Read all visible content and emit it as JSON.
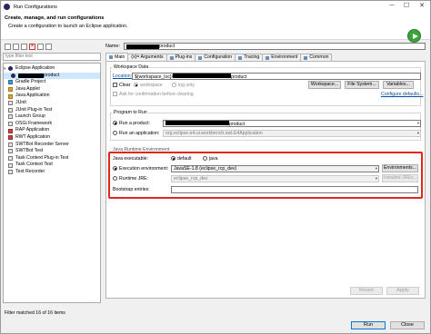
{
  "window": {
    "title": "Run Configurations",
    "min": "─",
    "max": "☐",
    "close": "✕"
  },
  "header": {
    "title": "Create, manage, and run configurations",
    "subtitle": "Create a configuration to launch an Eclipse application."
  },
  "left": {
    "filter_placeholder": "type filter text",
    "tree": [
      {
        "label": "Eclipse Application",
        "icon": "eclipse",
        "expanded": true
      },
      {
        "label": "product",
        "icon": "eclipse",
        "child": true,
        "selected": true
      },
      {
        "label": "Gradle Project",
        "icon": "gradle"
      },
      {
        "label": "Java Applet",
        "icon": "java"
      },
      {
        "label": "Java Application",
        "icon": "java"
      },
      {
        "label": "JUnit",
        "icon": "junit"
      },
      {
        "label": "JUnit Plug-in Test",
        "icon": "junit"
      },
      {
        "label": "Launch Group",
        "icon": "group"
      },
      {
        "label": "OSGi Framework",
        "icon": "osgi"
      },
      {
        "label": "RAP Application",
        "icon": "rap"
      },
      {
        "label": "RWT Application",
        "icon": "rap"
      },
      {
        "label": "SWTBot Recorder Server",
        "icon": "swtbot"
      },
      {
        "label": "SWTBot Test",
        "icon": "swtbot"
      },
      {
        "label": "Task Context Plug-in Test",
        "icon": "task"
      },
      {
        "label": "Task Context Test",
        "icon": "task"
      },
      {
        "label": "Test Recorder",
        "icon": "recorder"
      }
    ],
    "status": "Filter matched 16 of 16 items"
  },
  "form": {
    "name_label": "Name:",
    "name_value": "product",
    "tabs": [
      "Main",
      "(x)= Arguments",
      "Plug-ins",
      "Configuration",
      "Tracing",
      "Environment",
      "Common"
    ],
    "workspace": {
      "group": "Workspace Data",
      "location_label": "Location:",
      "location_value_prefix": "${workspace_loc}/",
      "location_value_suffix": "product",
      "clear_label": "Clear",
      "workspace_label": "workspace",
      "log_only_label": "log only",
      "ask_label": "Ask for confirmation before clearing",
      "btn_workspace": "Workspace...",
      "btn_filesystem": "File System...",
      "btn_variables": "Variables...",
      "configure_defaults": "Configure defaults..."
    },
    "program": {
      "group": "Program to Run",
      "run_product_label": "Run a product:",
      "run_product_value": "product",
      "run_app_label": "Run an application:",
      "run_app_value": "org.eclipse.e4.ui.workbench.swt.E4Application"
    },
    "java": {
      "group": "Java Runtime Environment",
      "executable_label": "Java executable:",
      "default_label": "default",
      "java_label": "java",
      "exec_env_label": "Execution environment:",
      "exec_env_value": "JavaSE-1.8 (eclipse_rcp_dev)",
      "environments_btn": "Environments...",
      "runtime_jre_label": "Runtime JRE:",
      "runtime_jre_value": "eclipse_rcp_dev",
      "installed_jres_btn": "Installed JREs...",
      "bootstrap_label": "Bootstrap entries:"
    },
    "revert": "Revert",
    "apply": "Apply"
  },
  "footer": {
    "run": "Run",
    "close": "Close"
  },
  "colors": {
    "highlight": "#e1261c",
    "selection": "#cce8ff",
    "link": "#0a4ea0"
  }
}
